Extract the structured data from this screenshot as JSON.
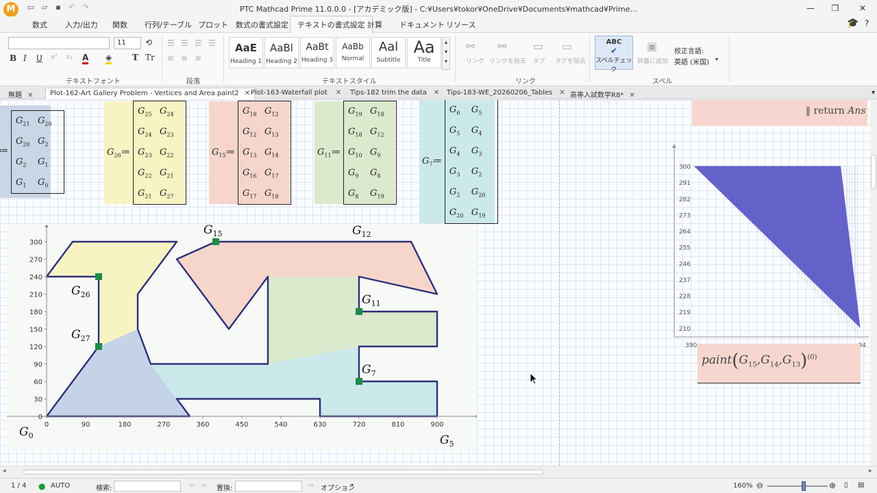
{
  "window": {
    "title": "PTC Mathcad Prime 11.0.0.0 - [アカデミック版] - C:¥Users¥tokor¥OneDrive¥Documents¥mathcad¥Prime...",
    "logo_letter": "M",
    "minimize": "—",
    "restore": "❐",
    "close": "✕"
  },
  "menu": {
    "items": [
      "数式",
      "入力/出力",
      "関数",
      "行列/テーブル",
      "プロット",
      "数式の書式設定",
      "テキストの書式設定",
      "計算",
      "ドキュメント",
      "リソース"
    ],
    "active_index": 6
  },
  "ribbon": {
    "font_name": "",
    "font_size": "11",
    "bold": "B",
    "italic": "I",
    "underline": "U",
    "groups": [
      "テキストフォント",
      "段落",
      "テキストスタイル",
      "リンク",
      "スペル"
    ],
    "styles": [
      {
        "preview": "AaE",
        "label": "Heading 1"
      },
      {
        "preview": "AaBl",
        "label": "Heading 2"
      },
      {
        "preview": "AaBt",
        "label": "Heading 3"
      },
      {
        "preview": "AaBb",
        "label": "Normal"
      },
      {
        "preview": "Aal",
        "label": "Subtitle"
      },
      {
        "preview": "Aa",
        "label": "Title"
      }
    ],
    "link_buttons": [
      "リンク",
      "リンクを除去",
      "タグ",
      "タグを除去"
    ],
    "spell_check": "スペルチェック",
    "spell_abc": "ABC",
    "add_dictionary": "辞書に追加",
    "proof_language_label": "校正言語:",
    "proof_language": "英語 (米国)"
  },
  "tabs": [
    {
      "label": "無題",
      "active": false
    },
    {
      "label": "Plot-162-Art Gallery Problem - Vertices and Area paint2",
      "active": true
    },
    {
      "label": "Plot-163-Waterfall plot",
      "active": false
    },
    {
      "label": "Tips-182 trim the data",
      "active": false
    },
    {
      "label": "Tips-183-WE_20260206_Tables",
      "active": false
    },
    {
      "label": "高専入試数学R8*",
      "active": false
    }
  ],
  "worksheet": {
    "matrices": [
      {
        "lhs": "27",
        "color": "#c9d6e6",
        "rows": [
          [
            "21",
            "20"
          ],
          [
            "20",
            "2"
          ],
          [
            "2",
            "1"
          ],
          [
            "1",
            "0"
          ]
        ]
      },
      {
        "lhs": "26",
        "color": "#f8f3c2",
        "rows": [
          [
            "25",
            "24"
          ],
          [
            "24",
            "23"
          ],
          [
            "23",
            "22"
          ],
          [
            "22",
            "21"
          ],
          [
            "21",
            "27"
          ]
        ]
      },
      {
        "lhs": "15",
        "color": "#f6d6cb",
        "rows": [
          [
            "18",
            "12"
          ],
          [
            "12",
            "13"
          ],
          [
            "13",
            "14"
          ],
          [
            "16",
            "17"
          ],
          [
            "17",
            "18"
          ]
        ]
      },
      {
        "lhs": "11",
        "color": "#dbe9cc",
        "rows": [
          [
            "19",
            "18"
          ],
          [
            "18",
            "12"
          ],
          [
            "10",
            "9"
          ],
          [
            "9",
            "8"
          ],
          [
            "8",
            "19"
          ]
        ]
      },
      {
        "lhs": "7",
        "color": "#cbe8ea",
        "rows": [
          [
            "6",
            "5"
          ],
          [
            "5",
            "4"
          ],
          [
            "4",
            "3"
          ],
          [
            "3",
            "2"
          ],
          [
            "2",
            "20"
          ],
          [
            "20",
            "19"
          ]
        ]
      }
    ],
    "return_keyword": "return",
    "return_var": "Ans",
    "paint": {
      "fn": "paint",
      "args": [
        "15",
        "14",
        "13"
      ],
      "sup": "(0)"
    }
  },
  "chart_data": [
    {
      "type": "area",
      "title": "",
      "xlabel": "G₅",
      "ylabel": "",
      "xlim": [
        0,
        990
      ],
      "ylim": [
        0,
        300
      ],
      "x_ticks": [
        0,
        90,
        180,
        270,
        360,
        450,
        540,
        630,
        720,
        810,
        900
      ],
      "y_ticks": [
        0,
        30,
        60,
        90,
        120,
        150,
        180,
        210,
        240,
        270,
        300
      ],
      "grid": false,
      "outline": [
        [
          0,
          0
        ],
        [
          330,
          0
        ],
        [
          300,
          30
        ],
        [
          630,
          30
        ],
        [
          630,
          0
        ],
        [
          900,
          0
        ],
        [
          900,
          60
        ],
        [
          720,
          60
        ],
        [
          720,
          120
        ],
        [
          900,
          120
        ],
        [
          900,
          180
        ],
        [
          720,
          180
        ],
        [
          720,
          240
        ],
        [
          900,
          210
        ],
        [
          840,
          300
        ],
        [
          390,
          300
        ],
        [
          300,
          270
        ],
        [
          420,
          150
        ],
        [
          510,
          240
        ],
        [
          510,
          90
        ],
        [
          240,
          90
        ],
        [
          210,
          150
        ],
        [
          210,
          210
        ],
        [
          300,
          300
        ],
        [
          60,
          300
        ],
        [
          0,
          240
        ],
        [
          120,
          240
        ],
        [
          120,
          120
        ]
      ],
      "regions": [
        {
          "name": "G27",
          "color": "#c5d3e8",
          "vertices": [
            [
              0,
              0
            ],
            [
              330,
              0
            ],
            [
              240,
              90
            ],
            [
              210,
              150
            ],
            [
              120,
              120
            ]
          ]
        },
        {
          "name": "G26",
          "color": "#f8f3c2",
          "vertices": [
            [
              120,
              120
            ],
            [
              210,
              150
            ],
            [
              210,
              210
            ],
            [
              300,
              300
            ],
            [
              60,
              300
            ],
            [
              0,
              240
            ],
            [
              120,
              240
            ]
          ]
        },
        {
          "name": "G15",
          "color": "#f6d6cb",
          "vertices": [
            [
              300,
              270
            ],
            [
              390,
              300
            ],
            [
              840,
              300
            ],
            [
              900,
              210
            ],
            [
              720,
              240
            ],
            [
              510,
              240
            ],
            [
              420,
              150
            ]
          ]
        },
        {
          "name": "G11",
          "color": "#dbe9cc",
          "vertices": [
            [
              510,
              240
            ],
            [
              720,
              240
            ],
            [
              720,
              180
            ],
            [
              900,
              180
            ],
            [
              900,
              120
            ],
            [
              720,
              120
            ],
            [
              510,
              90
            ]
          ]
        },
        {
          "name": "G7",
          "color": "#cbe8ea",
          "vertices": [
            [
              240,
              90
            ],
            [
              510,
              90
            ],
            [
              720,
              120
            ],
            [
              720,
              60
            ],
            [
              900,
              60
            ],
            [
              900,
              0
            ],
            [
              630,
              0
            ],
            [
              630,
              30
            ],
            [
              300,
              30
            ],
            [
              330,
              0
            ]
          ]
        }
      ],
      "points": [
        {
          "label": "G15",
          "x": 390,
          "y": 300
        },
        {
          "label": "G26",
          "x": 120,
          "y": 240
        },
        {
          "label": "G27",
          "x": 120,
          "y": 120
        },
        {
          "label": "G11",
          "x": 720,
          "y": 180
        },
        {
          "label": "G7",
          "x": 720,
          "y": 60
        },
        {
          "label": "G12",
          "x": 720,
          "y": 240
        },
        {
          "label": "G0",
          "x": 0,
          "y": 0
        }
      ],
      "outline_color": "#2e2f7a",
      "point_color": "#1e8a4a"
    },
    {
      "type": "area",
      "title": "",
      "xlabel": "",
      "ylabel": "",
      "ylim": [
        205,
        304
      ],
      "y_ticks": [
        210,
        219,
        228,
        237,
        246,
        255,
        264,
        273,
        282,
        291,
        300
      ],
      "x_ticks": [
        "390",
        "94"
      ],
      "triangle": [
        [
          390,
          300
        ],
        [
          840,
          300
        ],
        [
          900,
          210
        ]
      ],
      "color": "#5a56c4"
    }
  ],
  "status": {
    "page": "1 / 4",
    "auto": "AUTO",
    "search_label": "検索:",
    "replace_label": "置換:",
    "options": "オプション",
    "zoom": "160%"
  }
}
